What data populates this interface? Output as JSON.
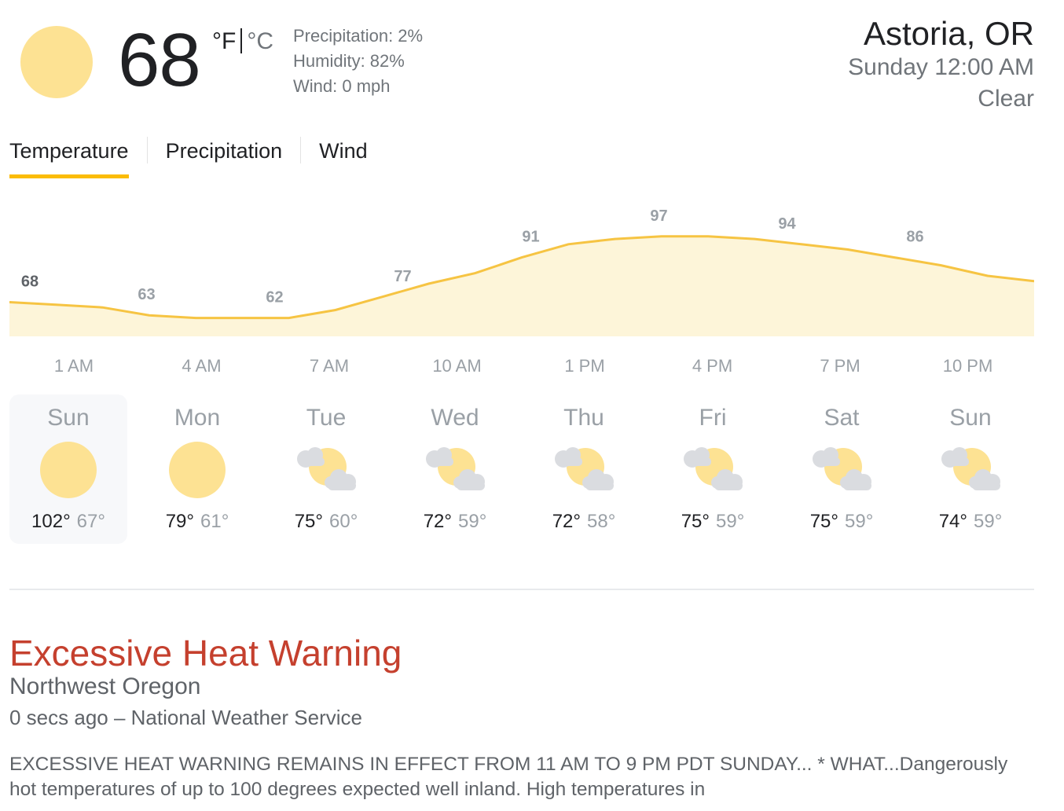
{
  "current": {
    "temperature": "68",
    "unit_f": "°F",
    "unit_c": "°C",
    "precipitation": "Precipitation: 2%",
    "humidity": "Humidity: 82%",
    "wind": "Wind: 0 mph",
    "icon": "sun-icon"
  },
  "location": {
    "name": "Astoria, OR",
    "datetime": "Sunday 12:00 AM",
    "condition": "Clear"
  },
  "tabs": [
    {
      "label": "Temperature",
      "active": true
    },
    {
      "label": "Precipitation",
      "active": false
    },
    {
      "label": "Wind",
      "active": false
    }
  ],
  "chart_data": {
    "type": "area",
    "title": "",
    "points_labels": [
      "68",
      "63",
      "62",
      "77",
      "91",
      "97",
      "94",
      "86"
    ],
    "values": [
      68,
      63,
      62,
      77,
      91,
      97,
      94,
      86
    ],
    "x": [
      "1 AM",
      "4 AM",
      "7 AM",
      "10 AM",
      "1 PM",
      "4 PM",
      "7 PM",
      "10 PM"
    ],
    "curve_values": [
      68,
      67,
      66,
      63,
      62,
      62,
      62,
      65,
      70,
      75,
      79,
      85,
      90,
      92,
      93,
      93,
      92,
      90,
      88,
      85,
      82,
      78,
      76
    ],
    "ylim": [
      55,
      105
    ],
    "line_color": "#f6c443",
    "fill_color": "#fdf5d9",
    "grid": false
  },
  "days": [
    {
      "name": "Sun",
      "icon": "sun-icon",
      "high": "102°",
      "low": "67°",
      "selected": true
    },
    {
      "name": "Mon",
      "icon": "sun-icon",
      "high": "79°",
      "low": "61°",
      "selected": false
    },
    {
      "name": "Tue",
      "icon": "partly-cloudy-night-icon",
      "high": "75°",
      "low": "60°",
      "selected": false
    },
    {
      "name": "Wed",
      "icon": "partly-cloudy-night-icon",
      "high": "72°",
      "low": "59°",
      "selected": false
    },
    {
      "name": "Thu",
      "icon": "partly-cloudy-night-icon",
      "high": "72°",
      "low": "58°",
      "selected": false
    },
    {
      "name": "Fri",
      "icon": "partly-cloudy-night-icon",
      "high": "75°",
      "low": "59°",
      "selected": false
    },
    {
      "name": "Sat",
      "icon": "partly-cloudy-night-icon",
      "high": "75°",
      "low": "59°",
      "selected": false
    },
    {
      "name": "Sun",
      "icon": "partly-cloudy-night-icon",
      "high": "74°",
      "low": "59°",
      "selected": false
    }
  ],
  "alert": {
    "title": "Excessive Heat Warning",
    "region": "Northwest Oregon",
    "meta": "0 secs ago – National Weather Service",
    "body": "EXCESSIVE HEAT WARNING REMAINS IN EFFECT FROM 11 AM TO 9 PM PDT SUNDAY... * WHAT...Dangerously hot temperatures of up to 100 degrees expected well inland. High temperatures in"
  },
  "colors": {
    "accent": "#fbbc04",
    "sun": "#fde293",
    "alert": "#c5402e",
    "cloud": "#dadce0"
  }
}
